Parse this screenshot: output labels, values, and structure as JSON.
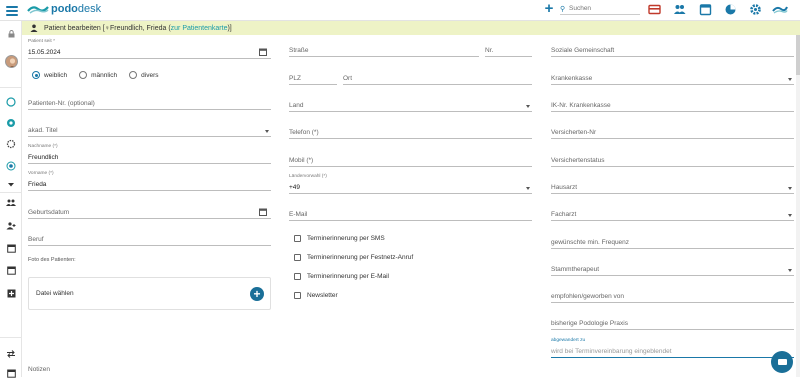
{
  "app": {
    "logo_text": "podo",
    "logo_text_bold": "desk"
  },
  "search": {
    "placeholder": "Suchen"
  },
  "banner": {
    "text": "Patient bearbeiten [♀Freundlich, Frieda (",
    "link": "zur Patientenkarte",
    "close": ")]"
  },
  "col1": {
    "patient_seit_label": "Patient seit *",
    "patient_seit_value": "15.05.2024",
    "gender": [
      {
        "label": "weiblich",
        "selected": true
      },
      {
        "label": "männlich",
        "selected": false
      },
      {
        "label": "divers",
        "selected": false
      }
    ],
    "patienten_nr": "Patienten-Nr. (optional)",
    "akad_titel": "akad. Titel",
    "nachname_label": "Nachname (*)",
    "nachname_value": "Freundlich",
    "vorname_label": "Vorname (*)",
    "vorname_value": "Frieda",
    "geburtsdatum": "Geburtsdatum",
    "beruf": "Beruf",
    "foto_label": "Foto des Patienten:",
    "datei_waehlen": "Datei wählen",
    "notizen": "Notizen"
  },
  "col2": {
    "strasse": "Straße",
    "nr": "Nr.",
    "plz": "PLZ",
    "ort": "Ort",
    "land": "Land",
    "telefon": "Telefon (*)",
    "mobil": "Mobil (*)",
    "laendervorwahl_label": "Ländervorwahl (*)",
    "laendervorwahl_value": "+49",
    "email": "E-Mail",
    "checks": [
      {
        "label": "Terminerinnerung per SMS",
        "checked": false
      },
      {
        "label": "Terminerinnerung per Festnetz-Anruf",
        "checked": false
      },
      {
        "label": "Terminerinnerung per E-Mail",
        "checked": false
      },
      {
        "label": "Newsletter",
        "checked": false
      }
    ]
  },
  "col3": {
    "soziale_gemeinschaft": "Soziale Gemeinschaft",
    "krankenkasse": "Krankenkasse",
    "ik_nr": "IK-Nr. Krankenkasse",
    "versicherten_nr": "Versicherten-Nr",
    "versichertenstatus": "Versichertenstatus",
    "hausarzt": "Hausarzt",
    "facharzt": "Facharzt",
    "frequenz": "gewünschte min. Frequenz",
    "stammtherapeut": "Stammtherapeut",
    "empfohlen": "empfohlen/geworben von",
    "bisherige_praxis": "bisherige Podologie Praxis",
    "abgewandert_label": "abgewandert zu",
    "abgewandert_placeholder": "wird bei Terminvereinbarung eingeblendet"
  },
  "colors": {
    "accent": "#1a78a8",
    "banner": "#eef3c6",
    "link": "#1a9ba8",
    "fab": "#1a6f98"
  }
}
